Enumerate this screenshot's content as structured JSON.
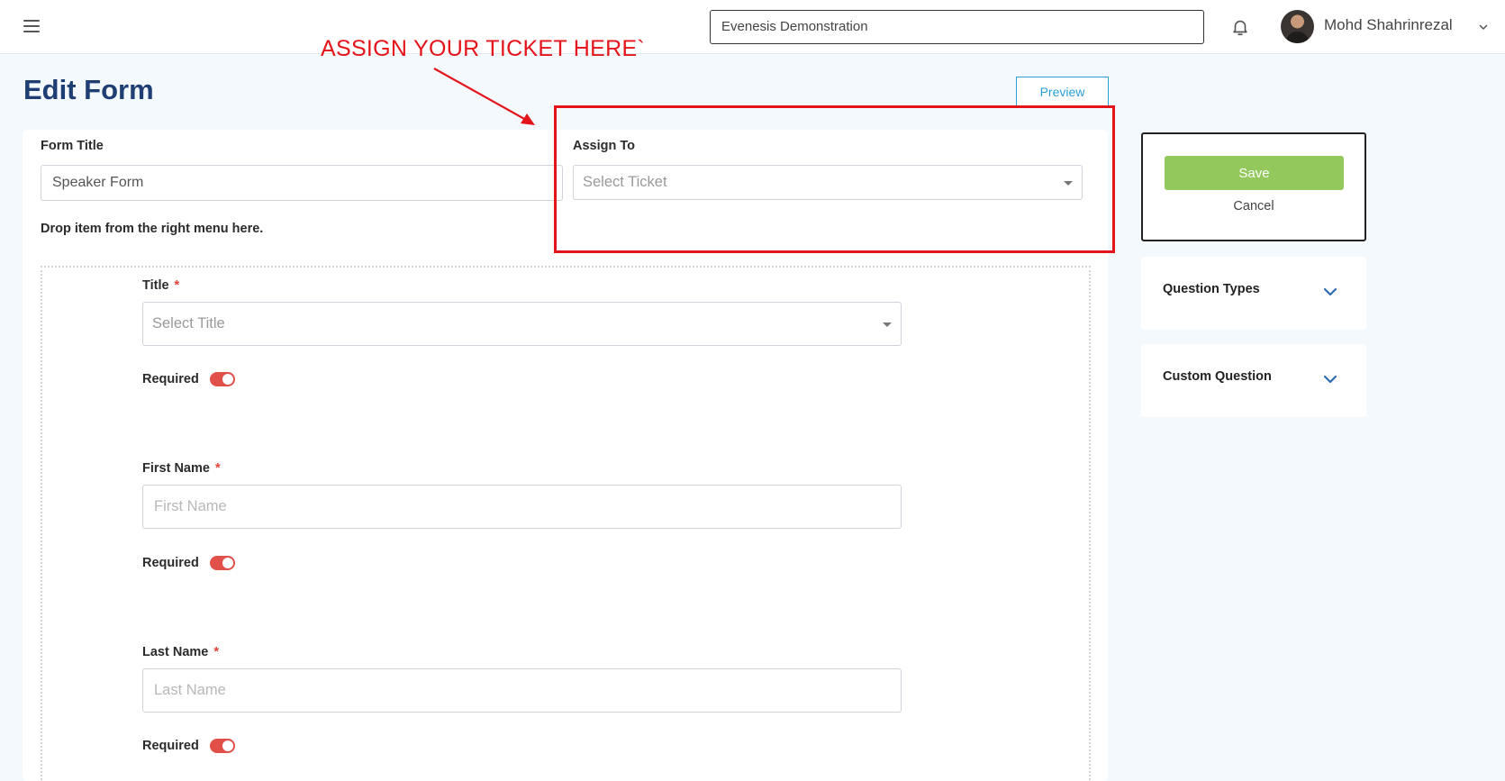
{
  "header": {
    "organization": "Evenesis Demonstration",
    "user_name": "Mohd Shahrinrezal"
  },
  "page": {
    "title": "Edit Form",
    "preview_label": "Preview"
  },
  "annotation": {
    "text": "ASSIGN YOUR TICKET HERE`",
    "color": "#e4141b"
  },
  "form": {
    "form_title_label": "Form Title",
    "form_title_value": "Speaker Form",
    "assign_to_label": "Assign To",
    "assign_to_placeholder": "Select Ticket",
    "drop_hint": "Drop item from the right menu here.",
    "fields": [
      {
        "label": "Title",
        "required_marker": "*",
        "placeholder": "Select Title",
        "required_label": "Required",
        "required_on": true
      },
      {
        "label": "First Name",
        "required_marker": "*",
        "placeholder": "First Name",
        "required_label": "Required",
        "required_on": true
      },
      {
        "label": "Last Name",
        "required_marker": "*",
        "placeholder": "Last Name",
        "required_label": "Required",
        "required_on": true
      }
    ]
  },
  "sidebar": {
    "save_label": "Save",
    "cancel_label": "Cancel",
    "panels": [
      {
        "title": "Question Types"
      },
      {
        "title": "Custom Question"
      }
    ]
  },
  "colors": {
    "save_button": "#93c95c",
    "title_text": "#1f3f74",
    "toggle_on": "#e2504a",
    "preview_accent": "#2a9fd8"
  },
  "icons": {
    "menu": "hamburger-menu-icon",
    "notifications": "bell-icon",
    "dropdown": "chevron-down-icon"
  }
}
